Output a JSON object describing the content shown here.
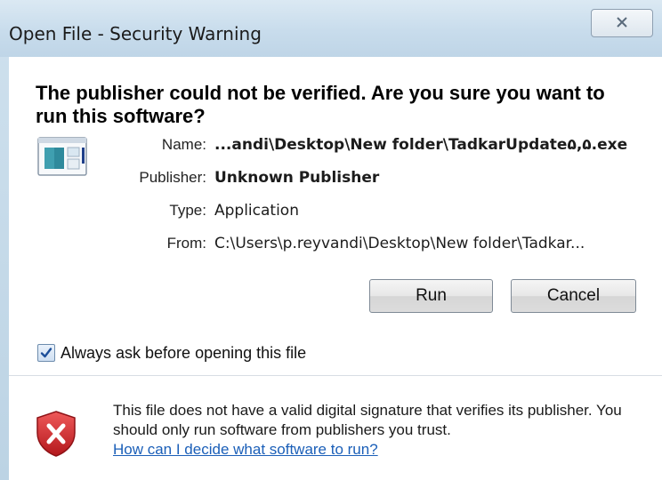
{
  "window": {
    "title": "Open File - Security Warning",
    "close_icon": "close-icon"
  },
  "dialog": {
    "headline": "The publisher could not be verified.  Are you sure you want to run this software?",
    "file_icon": "application-file-icon",
    "details": [
      {
        "label": "Name:",
        "value": "...andi\\Desktop\\New folder\\TadkarUpdate۵,۵.exe",
        "bold": true
      },
      {
        "label": "Publisher:",
        "value": "Unknown Publisher",
        "bold": true
      },
      {
        "label": "Type:",
        "value": "Application",
        "bold": false
      },
      {
        "label": "From:",
        "value": "C:\\Users\\p.reyvandi\\Desktop\\New folder\\Tadkar...",
        "bold": false
      }
    ],
    "buttons": {
      "run": "Run",
      "cancel": "Cancel"
    },
    "checkbox": {
      "label": "Always ask before opening this file",
      "checked": true
    }
  },
  "warning": {
    "icon": "shield-error-icon",
    "text": "This file does not have a valid digital signature that verifies its publisher.  You should only run software from publishers you trust.",
    "link": "How can I decide what software to run?"
  },
  "colors": {
    "frame": "#c8dcec",
    "link": "#1b5fb8",
    "shield_red": "#c8262b"
  }
}
